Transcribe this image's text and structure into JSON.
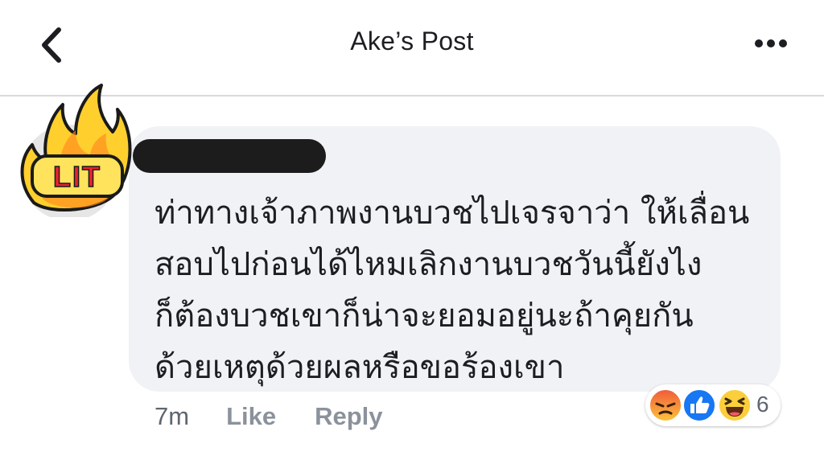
{
  "header": {
    "title": "Ake’s Post",
    "back_icon": "chevron-left-icon",
    "more_icon": "more-horizontal-icon"
  },
  "comment": {
    "avatar_badge_text": "LIT",
    "avatar_icon": "fire-lit-icon",
    "author_name_redacted": true,
    "text_lines": [
      "ท่าทางเจ้าภาพงานบวชไปเจรจาว่า ให้เลื่อน",
      "สอบไปก่อนได้ไหมเลิกงานบวชวันนี้ยังไง",
      "ก็ต้องบวชเขาก็น่าจะยอมอยู่นะถ้าคุยกัน",
      "ด้วยเหตุด้วยผลหรือขอร้องเขา"
    ],
    "time": "7m",
    "like_label": "Like",
    "reply_label": "Reply",
    "reactions": {
      "icons": [
        "angry-icon",
        "like-icon",
        "haha-icon"
      ],
      "count": "6"
    }
  },
  "colors": {
    "bubble": "#f1f2f6",
    "text": "#1c1e21",
    "meta": "#8b929c",
    "like_blue": "#1877f2"
  }
}
